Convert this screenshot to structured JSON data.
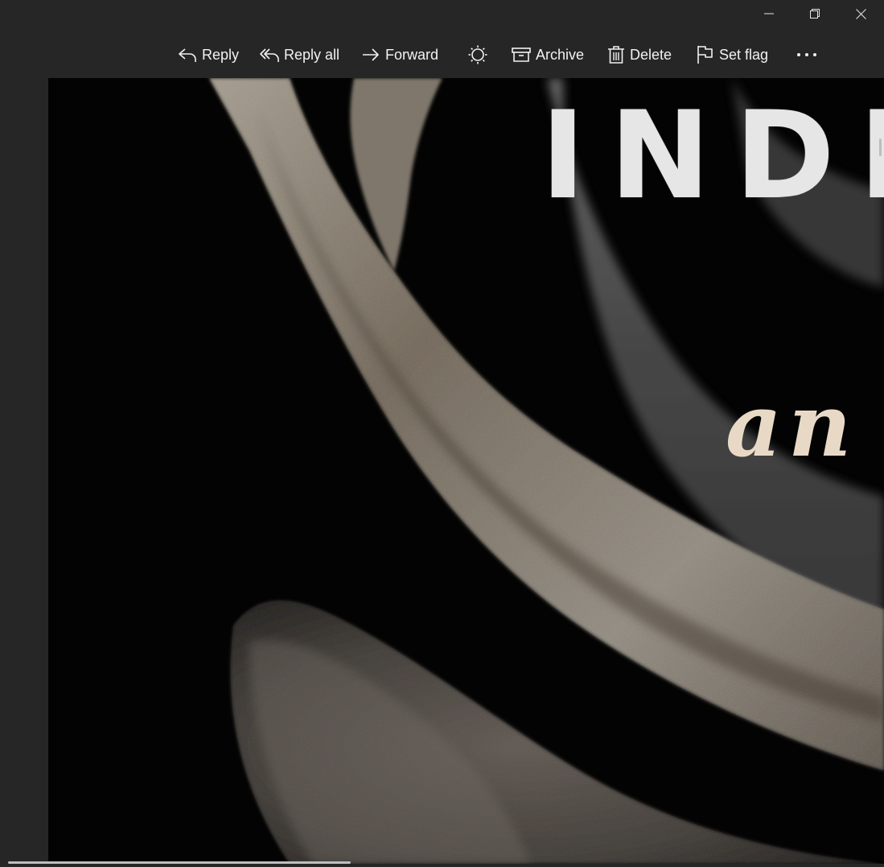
{
  "window": {
    "controls": [
      "minimize",
      "restore",
      "close"
    ]
  },
  "toolbar": {
    "reply_label": "Reply",
    "reply_all_label": "Reply all",
    "forward_label": "Forward",
    "archive_label": "Archive",
    "delete_label": "Delete",
    "set_flag_label": "Set flag"
  },
  "content": {
    "title_fragment": "INDI",
    "subtitle_fragment": "an"
  },
  "colors": {
    "background": "#262626",
    "toolbar_text": "#f2f2f2",
    "title_text": "#e6e6e6",
    "subtitle_text": "#e8d9c6"
  }
}
